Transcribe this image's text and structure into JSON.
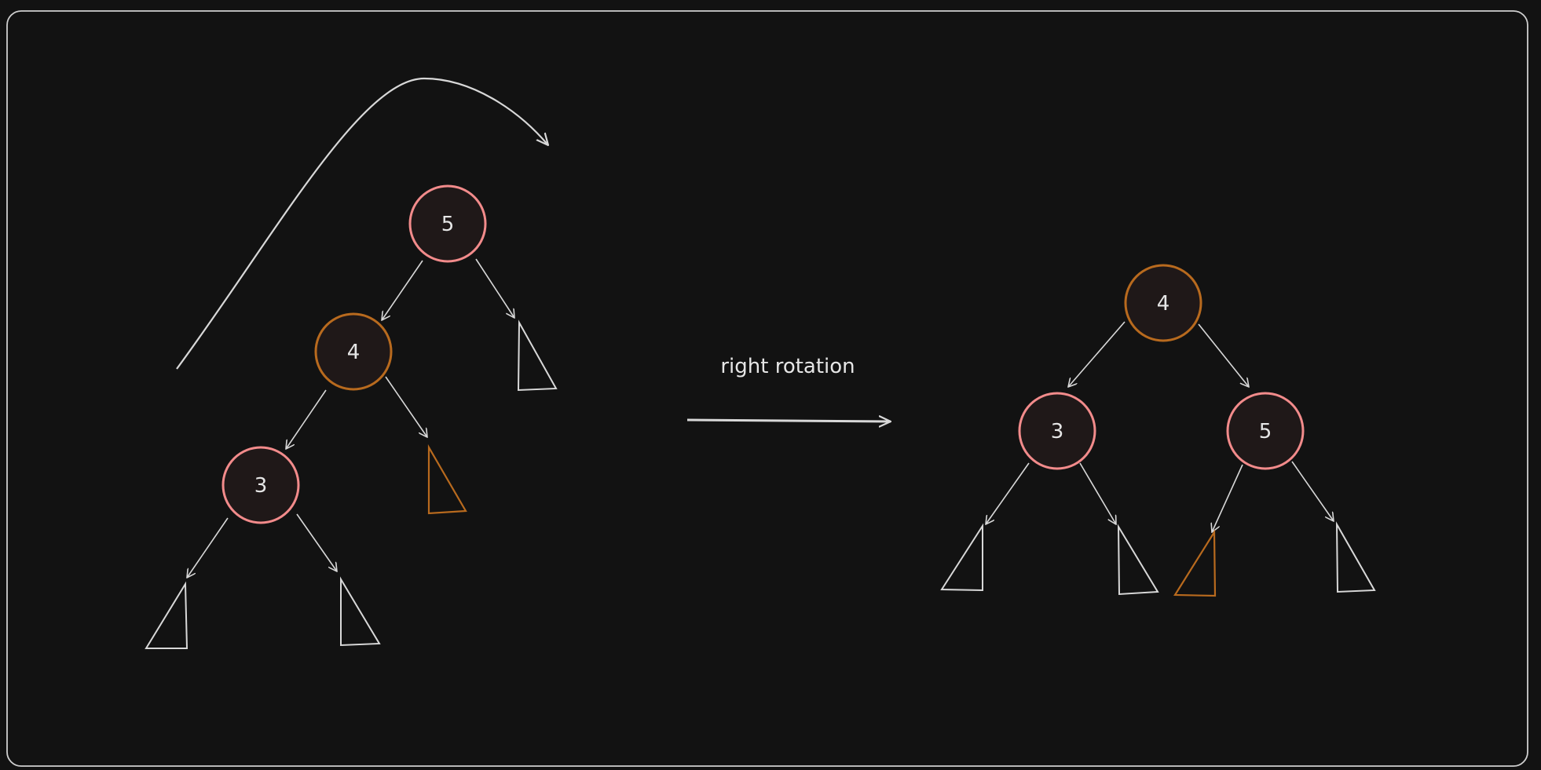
{
  "colors": {
    "background": "#121212",
    "frame_stroke": "#cfcfcf",
    "line": "#d8d8d8",
    "red_node_stroke": "#f28b8b",
    "orange_node_stroke": "#b86a1e",
    "node_fill": "#1f1818",
    "text": "#e6e6e6"
  },
  "before_tree": {
    "root": {
      "value": "5",
      "color": "red"
    },
    "left": {
      "value": "4",
      "color": "orange"
    },
    "left_left": {
      "value": "3",
      "color": "red"
    }
  },
  "after_tree": {
    "root": {
      "value": "4",
      "color": "orange"
    },
    "left": {
      "value": "3",
      "color": "red"
    },
    "right": {
      "value": "5",
      "color": "red"
    }
  },
  "rotation_label": "right rotation",
  "icons": {
    "subtree": "triangle-icon",
    "moved_subtree": "triangle-icon-orange",
    "arrow": "arrow-icon",
    "curved_arrow": "curved-arrow-icon"
  }
}
